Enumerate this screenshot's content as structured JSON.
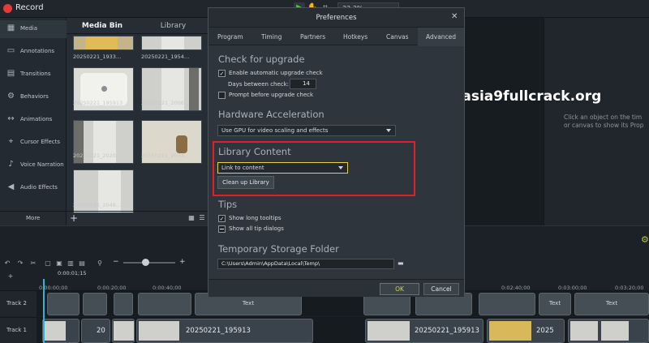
{
  "app": {
    "record_label": "Record",
    "zoom_value": "32.3%"
  },
  "sidebar": {
    "items": [
      {
        "label": "Media",
        "icon": "film-icon"
      },
      {
        "label": "Annotations",
        "icon": "annotation-icon"
      },
      {
        "label": "Transitions",
        "icon": "transition-icon"
      },
      {
        "label": "Behaviors",
        "icon": "behavior-icon"
      },
      {
        "label": "Animations",
        "icon": "animation-icon"
      },
      {
        "label": "Cursor Effects",
        "icon": "cursor-icon"
      },
      {
        "label": "Voice Narration",
        "icon": "microphone-icon"
      },
      {
        "label": "Audio Effects",
        "icon": "speaker-icon"
      }
    ],
    "more_label": "More"
  },
  "media_bin": {
    "tabs": [
      "Media Bin",
      "Library"
    ],
    "thumbnails": [
      "20250221_1933…",
      "20250221_1954…",
      "20250221_195913",
      "20250221_2006…",
      "20250221_2020…",
      "20250221_2034…",
      "20250221_2046…"
    ]
  },
  "watermark": "camtasia9fullcrack.org",
  "properties_hint": {
    "line1": "Click an object on the tim",
    "line2": "or canvas to show its Prop"
  },
  "dialog": {
    "title": "Preferences",
    "tabs": [
      "Program",
      "Timing",
      "Partners",
      "Hotkeys",
      "Canvas",
      "Advanced"
    ],
    "check_upgrade": {
      "title": "Check for upgrade",
      "enable_label": "Enable automatic upgrade check",
      "days_label": "Days between check:",
      "days_value": "14",
      "prompt_label": "Prompt before upgrade check"
    },
    "hardware": {
      "title": "Hardware Acceleration",
      "select_value": "Use GPU for video scaling and effects"
    },
    "library": {
      "title": "Library Content",
      "select_value": "Link to content",
      "cleanup_label": "Clean up Library"
    },
    "tips": {
      "title": "Tips",
      "long_tooltips": "Show long tooltips",
      "all_dialogs": "Show all tip dialogs"
    },
    "storage": {
      "title": "Temporary Storage Folder",
      "path": "C:\\Users\\Admin\\AppData\\Local\\Temp\\"
    },
    "ok_label": "OK",
    "cancel_label": "Cancel"
  },
  "timeline": {
    "playhead_time": "0:00:01;15",
    "ruler": [
      "0:00:00;00",
      "0:00:20;00",
      "0:00:40;00",
      "0:02:40;00",
      "0:03:00;00",
      "0:03:20;00"
    ],
    "tracks": [
      "Track 2",
      "Track 1"
    ],
    "clip_text": "Text",
    "clip_names": [
      "20",
      "20250221_195913",
      "20250221_195913",
      "2025"
    ]
  }
}
